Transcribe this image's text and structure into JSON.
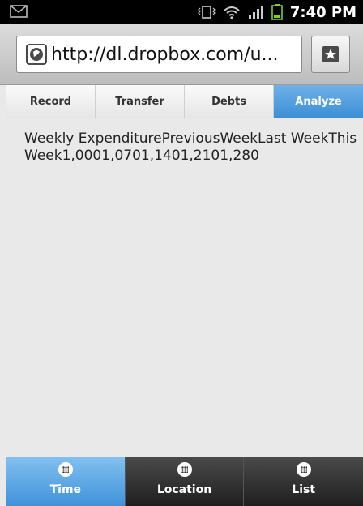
{
  "status_bar": {
    "time": "7:40 PM",
    "icons": [
      "mail-icon",
      "vibrate-icon",
      "wifi-icon",
      "signal-icon",
      "battery-icon"
    ]
  },
  "url_bar": {
    "url": "http://dl.dropbox.com/u...",
    "globe_icon": "globe-icon",
    "bookmark_icon": "bookmark-star-icon"
  },
  "tabs": [
    {
      "label": "Record",
      "active": false
    },
    {
      "label": "Transfer",
      "active": false
    },
    {
      "label": "Debts",
      "active": false
    },
    {
      "label": "Analyze",
      "active": true
    }
  ],
  "content": {
    "chart_fallback_text": "Weekly ExpenditurePreviousWeekLast WeekThis Week1,0001,0701,1401,2101,280"
  },
  "navbar": [
    {
      "label": "Time",
      "icon": "grid-icon",
      "active": true
    },
    {
      "label": "Location",
      "icon": "grid-icon",
      "active": false
    },
    {
      "label": "List",
      "icon": "grid-icon",
      "active": false
    }
  ],
  "colors": {
    "accent": "#3d8fd6",
    "status_bar": "#000000",
    "background": "#e9e9e9"
  }
}
